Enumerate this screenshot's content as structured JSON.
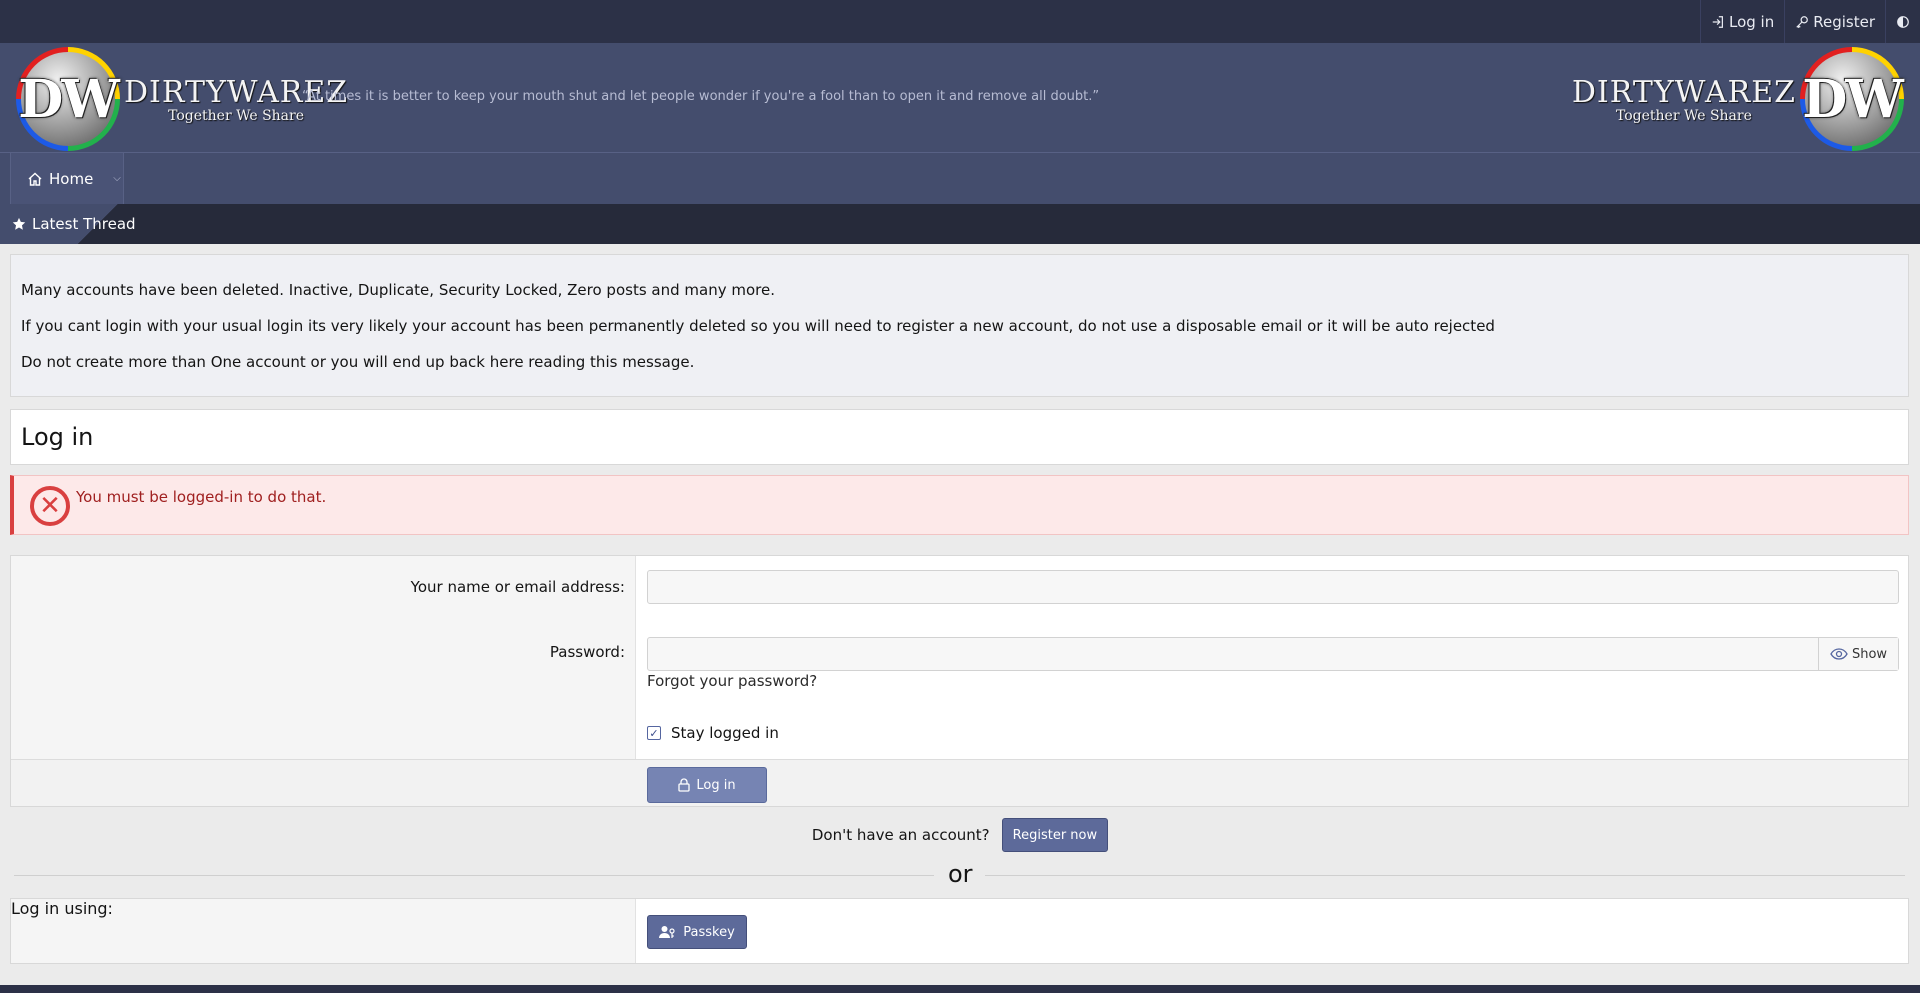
{
  "topbar": {
    "login_label": "Log in",
    "register_label": "Register"
  },
  "header": {
    "logo_mark": "DW",
    "logo_name": "DIRTYWAREZ",
    "logo_tagline": "Together We Share",
    "quote": "“At times it is better to keep your mouth shut and let people wonder if you're a fool than to open it and remove all doubt.”"
  },
  "nav": {
    "home_label": "Home",
    "latest_label": "Latest Thread"
  },
  "notice": {
    "lines": [
      "Many accounts have been deleted. Inactive, Duplicate, Security Locked, Zero posts and many more.",
      "If you cant login with your usual login its very likely your account has been permanently deleted so you will need to register a new account, do not use a disposable email or it will be auto rejected",
      "Do not create more than One account or you will end up back here reading this message."
    ]
  },
  "page": {
    "title": "Log in",
    "error": "You must be logged-in to do that."
  },
  "form": {
    "username_label": "Your name or email address:",
    "username_value": "",
    "password_label": "Password:",
    "password_value": "",
    "show_label": "Show",
    "forgot_label": "Forgot your password?",
    "stay_label": "Stay logged in",
    "stay_checked": true,
    "submit_label": "Log in"
  },
  "register": {
    "prompt": "Don't have an account?",
    "button_label": "Register now"
  },
  "divider": {
    "or_label": "or"
  },
  "alt_login": {
    "label": "Log in using:",
    "passkey_label": "Passkey"
  },
  "colors": {
    "topbar": "#2c3147",
    "header": "#444d6d",
    "accent_button": "#5d6a9a",
    "error_red": "#d94040"
  }
}
